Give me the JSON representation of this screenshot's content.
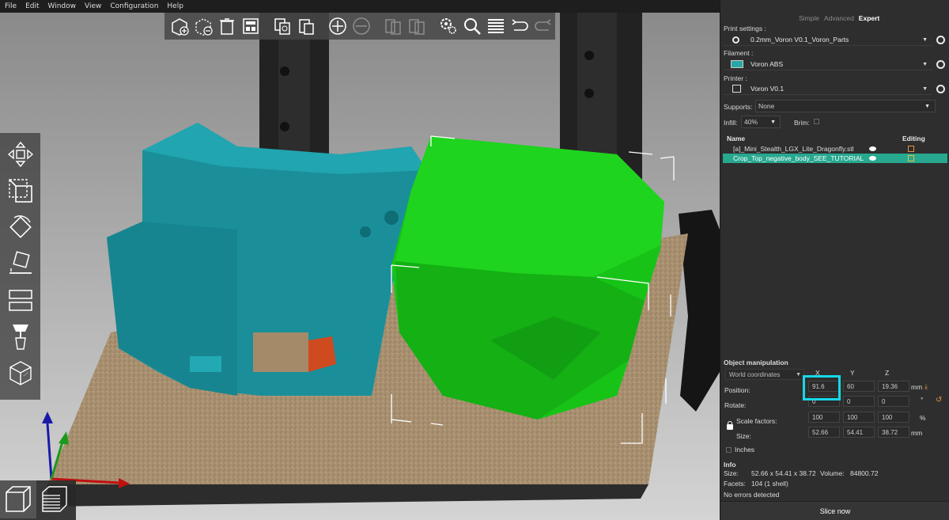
{
  "menu": [
    "File",
    "Edit",
    "Window",
    "View",
    "Configuration",
    "Help"
  ],
  "toolbar": {
    "buttons": [
      "add-icon",
      "delete-icon",
      "delete-all-icon",
      "arrange-icon",
      "copy-icon",
      "paste-icon",
      "add-instance-icon",
      "remove-instance-icon",
      "split-objects-icon",
      "split-parts-icon",
      "settings-icon",
      "search-icon",
      "layers-icon",
      "undo-icon",
      "redo-icon"
    ]
  },
  "left_toolbar": [
    "move-icon",
    "scale-icon",
    "rotate-icon",
    "place-on-face-icon",
    "cut-icon",
    "paint-supports-icon",
    "seam-icon"
  ],
  "sidebar": {
    "modes": [
      "Simple",
      "Advanced",
      "Expert"
    ],
    "active_mode": "Expert",
    "print_settings_label": "Print settings :",
    "print_settings_value": "0.2mm_Voron V0.1_Voron_Parts",
    "filament_label": "Filament :",
    "filament_value": "Voron ABS",
    "filament_color": "#2aa6a8",
    "printer_label": "Printer :",
    "printer_value": "Voron V0.1",
    "supports_label": "Supports:",
    "supports_value": "None",
    "infill_label": "Infill:",
    "infill_value": "40%",
    "brim_label": "Brim:",
    "list_header_name": "Name",
    "list_header_editing": "Editing",
    "objects": [
      {
        "name": "[a]_Mini_Stealth_LGX_Lite_Dragonfly.stl",
        "selected": false
      },
      {
        "name": "Crop_Top_negative_body_SEE_TUTORIAL",
        "selected": true
      }
    ]
  },
  "manipulation": {
    "title": "Object manipulation",
    "coords": "World coordinates",
    "x_head": "X",
    "y_head": "Y",
    "z_head": "Z",
    "position_label": "Position:",
    "pos_x": "91.6",
    "pos_y": "60",
    "pos_z": "19.36",
    "pos_unit": "mm",
    "rotate_label": "Rotate:",
    "rot_x": "0",
    "rot_y": "0",
    "rot_z": "0",
    "rot_unit": "°",
    "scale_label": "Scale factors:",
    "scale_x": "100",
    "scale_y": "100",
    "scale_z": "100",
    "scale_unit": "%",
    "size_label": "Size:",
    "size_x": "52.66",
    "size_y": "54.41",
    "size_z": "38.72",
    "size_unit": "mm",
    "inches_label": "Inches"
  },
  "info": {
    "title": "Info",
    "size_label": "Size:",
    "size_value": "52.66 x 54.41 x 38.72",
    "volume_label": "Volume:",
    "volume_value": "84800.72",
    "facets_label": "Facets:",
    "facets_value": "104 (1 shell)",
    "errors": "No errors detected"
  },
  "slice_button": "Slice now",
  "colors": {
    "selected_row": "#27a88f",
    "highlight": "#16d8e8",
    "model_teal": "#1a8f9a",
    "model_green": "#1fc41f"
  }
}
